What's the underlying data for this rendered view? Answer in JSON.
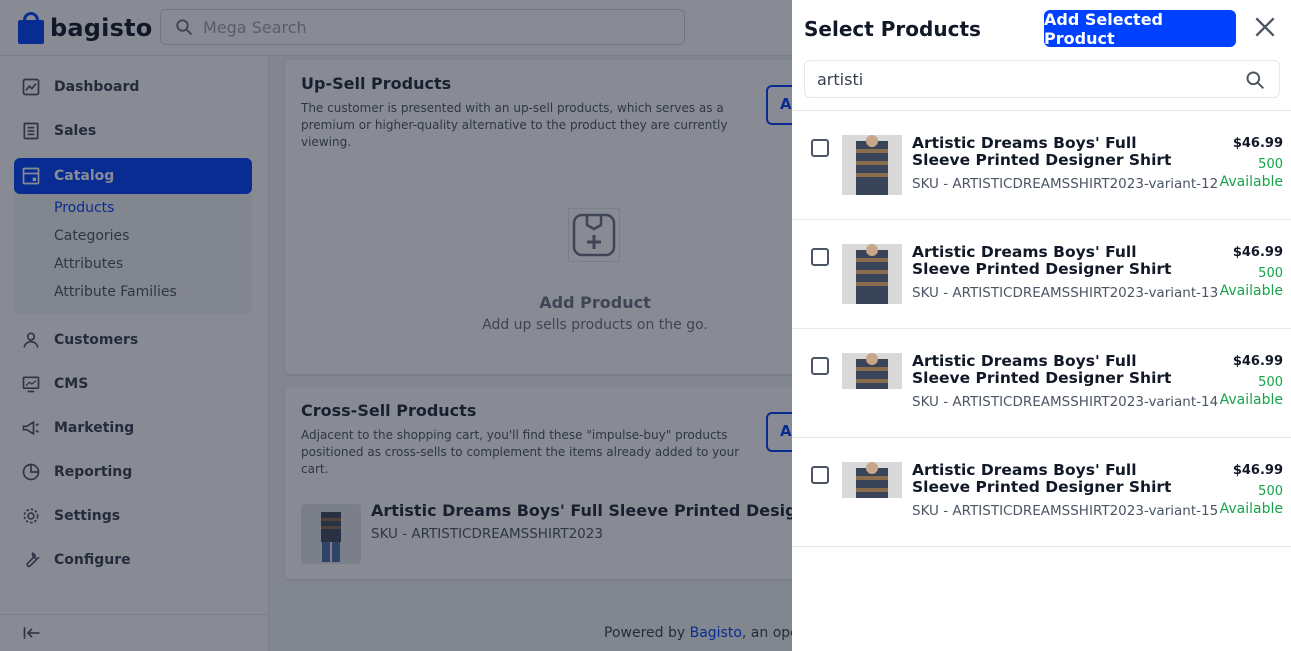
{
  "header": {
    "logo_text": "bagisto",
    "search_placeholder": "Mega Search"
  },
  "sidebar": {
    "items": [
      {
        "label": "Dashboard",
        "icon": "dashboard-icon"
      },
      {
        "label": "Sales",
        "icon": "sales-icon"
      },
      {
        "label": "Catalog",
        "icon": "catalog-icon",
        "active": true
      },
      {
        "label": "Customers",
        "icon": "customers-icon"
      },
      {
        "label": "CMS",
        "icon": "cms-icon"
      },
      {
        "label": "Marketing",
        "icon": "marketing-icon"
      },
      {
        "label": "Reporting",
        "icon": "reporting-icon"
      },
      {
        "label": "Settings",
        "icon": "settings-icon"
      },
      {
        "label": "Configure",
        "icon": "configure-icon"
      }
    ],
    "catalog_sub": [
      "Products",
      "Categories",
      "Attributes",
      "Attribute Families"
    ]
  },
  "upsell": {
    "title": "Up-Sell Products",
    "desc": "The customer is presented with an up-sell products, which serves as a premium or higher-quality alternative to the product they are currently viewing.",
    "btn": "A",
    "empty_title": "Add Product",
    "empty_sub": "Add up sells products on the go."
  },
  "crosssell": {
    "title": "Cross-Sell Products",
    "desc": "Adjacent to the shopping cart, you'll find these \"impulse-buy\" products positioned as cross-sells to complement the items already added to your cart.",
    "btn": "A",
    "product_name": "Artistic Dreams Boys' Full Sleeve Printed Designer Shirt",
    "product_sku": "SKU - ARTISTICDREAMSSHIRT2023"
  },
  "footer": {
    "prefix": "Powered by ",
    "link": "Bagisto",
    "suffix": ", an open-"
  },
  "drawer": {
    "title": "Select Products",
    "add_btn": "Add Selected Product",
    "search_value": "artisti",
    "products": [
      {
        "name": "Artistic Dreams Boys' Full Sleeve Printed Designer Shirt",
        "sku": "SKU - ARTISTICDREAMSSHIRT2023-variant-12",
        "price": "$46.99",
        "qty": "500",
        "avail": "Available"
      },
      {
        "name": "Artistic Dreams Boys' Full Sleeve Printed Designer Shirt",
        "sku": "SKU - ARTISTICDREAMSSHIRT2023-variant-13",
        "price": "$46.99",
        "qty": "500",
        "avail": "Available"
      },
      {
        "name": "Artistic Dreams Boys' Full Sleeve Printed Designer Shirt",
        "sku": "SKU - ARTISTICDREAMSSHIRT2023-variant-14",
        "price": "$46.99",
        "qty": "500",
        "avail": "Available"
      },
      {
        "name": "Artistic Dreams Boys' Full Sleeve Printed Designer Shirt",
        "sku": "SKU - ARTISTICDREAMSSHIRT2023-variant-15",
        "price": "$46.99",
        "qty": "500",
        "avail": "Available"
      }
    ]
  },
  "colors": {
    "brand": "#0041ff",
    "available": "#16a34a"
  }
}
